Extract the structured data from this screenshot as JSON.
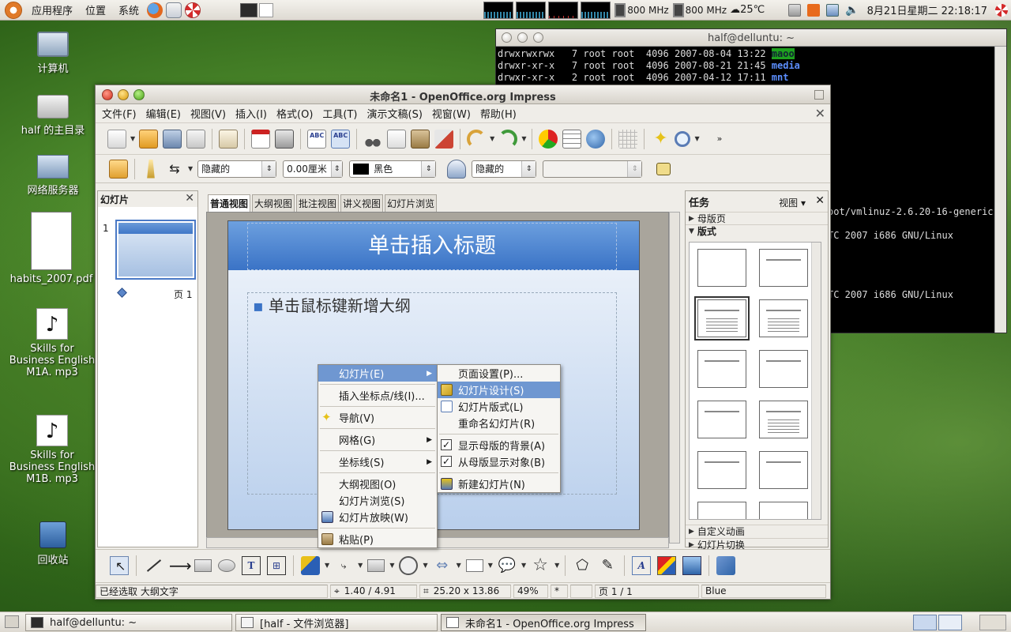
{
  "top_panel": {
    "menus": [
      "应用程序",
      "位置",
      "系统"
    ],
    "cpu_freq_1": "800 MHz",
    "cpu_freq_2": "800 MHz",
    "weather": "25℃",
    "clock": "8月21日星期二 22:18:17"
  },
  "desktop_icons": [
    {
      "label": "计算机",
      "icon": "computer-icon"
    },
    {
      "label": "half 的主目录",
      "icon": "home-folder-icon"
    },
    {
      "label": "网络服务器",
      "icon": "network-icon"
    },
    {
      "label": "habits_2007.pdf",
      "icon": "pdf-file-icon"
    },
    {
      "label": "Skills for Business English M1A. mp3",
      "icon": "audio-file-icon"
    },
    {
      "label": "Skills for Business English M1B. mp3",
      "icon": "audio-file-icon"
    },
    {
      "label": "回收站",
      "icon": "trash-icon"
    }
  ],
  "terminal": {
    "title": "half@delluntu: ~",
    "lines": [
      {
        "text": "drwxrwxrwx   7 root root  4096 2007-08-04 13:22 ",
        "name": "maoo",
        "hl": true
      },
      {
        "text": "drwxr-xr-x   7 root root  4096 2007-08-21 21:45 ",
        "name": "media",
        "hl": false
      },
      {
        "text": "drwxr-xr-x   2 root root  4096 2007-04-12 17:11 ",
        "name": "mnt",
        "hl": false
      }
    ],
    "partial_1": "oot/vmlinuz-2.6.20-16-generic",
    "partial_2": "TC 2007 i686 GNU/Linux",
    "partial_3": "TC 2007 i686 GNU/Linux"
  },
  "impress": {
    "title": "未命名1 - OpenOffice.org Impress",
    "menu": [
      "文件(F)",
      "编辑(E)",
      "视图(V)",
      "插入(I)",
      "格式(O)",
      "工具(T)",
      "演示文稿(S)",
      "视窗(W)",
      "帮助(H)"
    ],
    "line_style": "隐藏的",
    "line_width": "0.00厘米",
    "line_color": "黑色",
    "area_style": "隐藏的",
    "area_fill": "",
    "slides_pane_title": "幻灯片",
    "slide_number": "1",
    "slide_page_label": "页 1",
    "tabs": [
      "普通视图",
      "大纲视图",
      "批注视图",
      "讲义视图",
      "幻灯片浏览"
    ],
    "slide_title_placeholder": "单击插入标题",
    "slide_body_placeholder": "单击鼠标键新增大纲",
    "tasks": {
      "title": "任务",
      "view_label": "视图",
      "master_pages": "母版页",
      "layouts": "版式",
      "custom_animation": "自定义动画",
      "slide_transition": "幻灯片切换"
    },
    "status": {
      "selection": "已经选取 大纲文字",
      "position": "1.40 / 4.91",
      "size": "25.20 x 13.86",
      "zoom": "49%",
      "modified": "*",
      "page": "页 1 / 1",
      "master": "Blue"
    }
  },
  "context_menu": {
    "items": [
      {
        "label": "幻灯片(E)",
        "submenu": true,
        "highlighted": true
      },
      {
        "label": "插入坐标点/线(I)...",
        "submenu": false
      },
      {
        "label": "导航(V)",
        "submenu": false,
        "icon": "navigator-star-icon"
      },
      {
        "label": "网格(G)",
        "submenu": true
      },
      {
        "label": "坐标线(S)",
        "submenu": true
      },
      {
        "label": "大纲视图(O)",
        "submenu": false
      },
      {
        "label": "幻灯片浏览(S)",
        "submenu": false
      },
      {
        "label": "幻灯片放映(W)",
        "submenu": false,
        "icon": "slideshow-icon"
      },
      {
        "label": "粘贴(P)",
        "submenu": false,
        "icon": "paste-icon"
      }
    ]
  },
  "submenu": {
    "items": [
      {
        "label": "页面设置(P)..."
      },
      {
        "label": "幻灯片设计(S)",
        "highlighted": true
      },
      {
        "label": "幻灯片版式(L)"
      },
      {
        "label": "重命名幻灯片(R)"
      },
      {
        "label": "显示母版的背景(A)",
        "checked": true
      },
      {
        "label": "从母版显示对象(B)",
        "checked": true
      },
      {
        "label": "新建幻灯片(N)"
      }
    ]
  },
  "taskbar": {
    "items": [
      "half@delluntu: ~",
      "[half - 文件浏览器]",
      "未命名1 - OpenOffice.org Impress"
    ]
  }
}
